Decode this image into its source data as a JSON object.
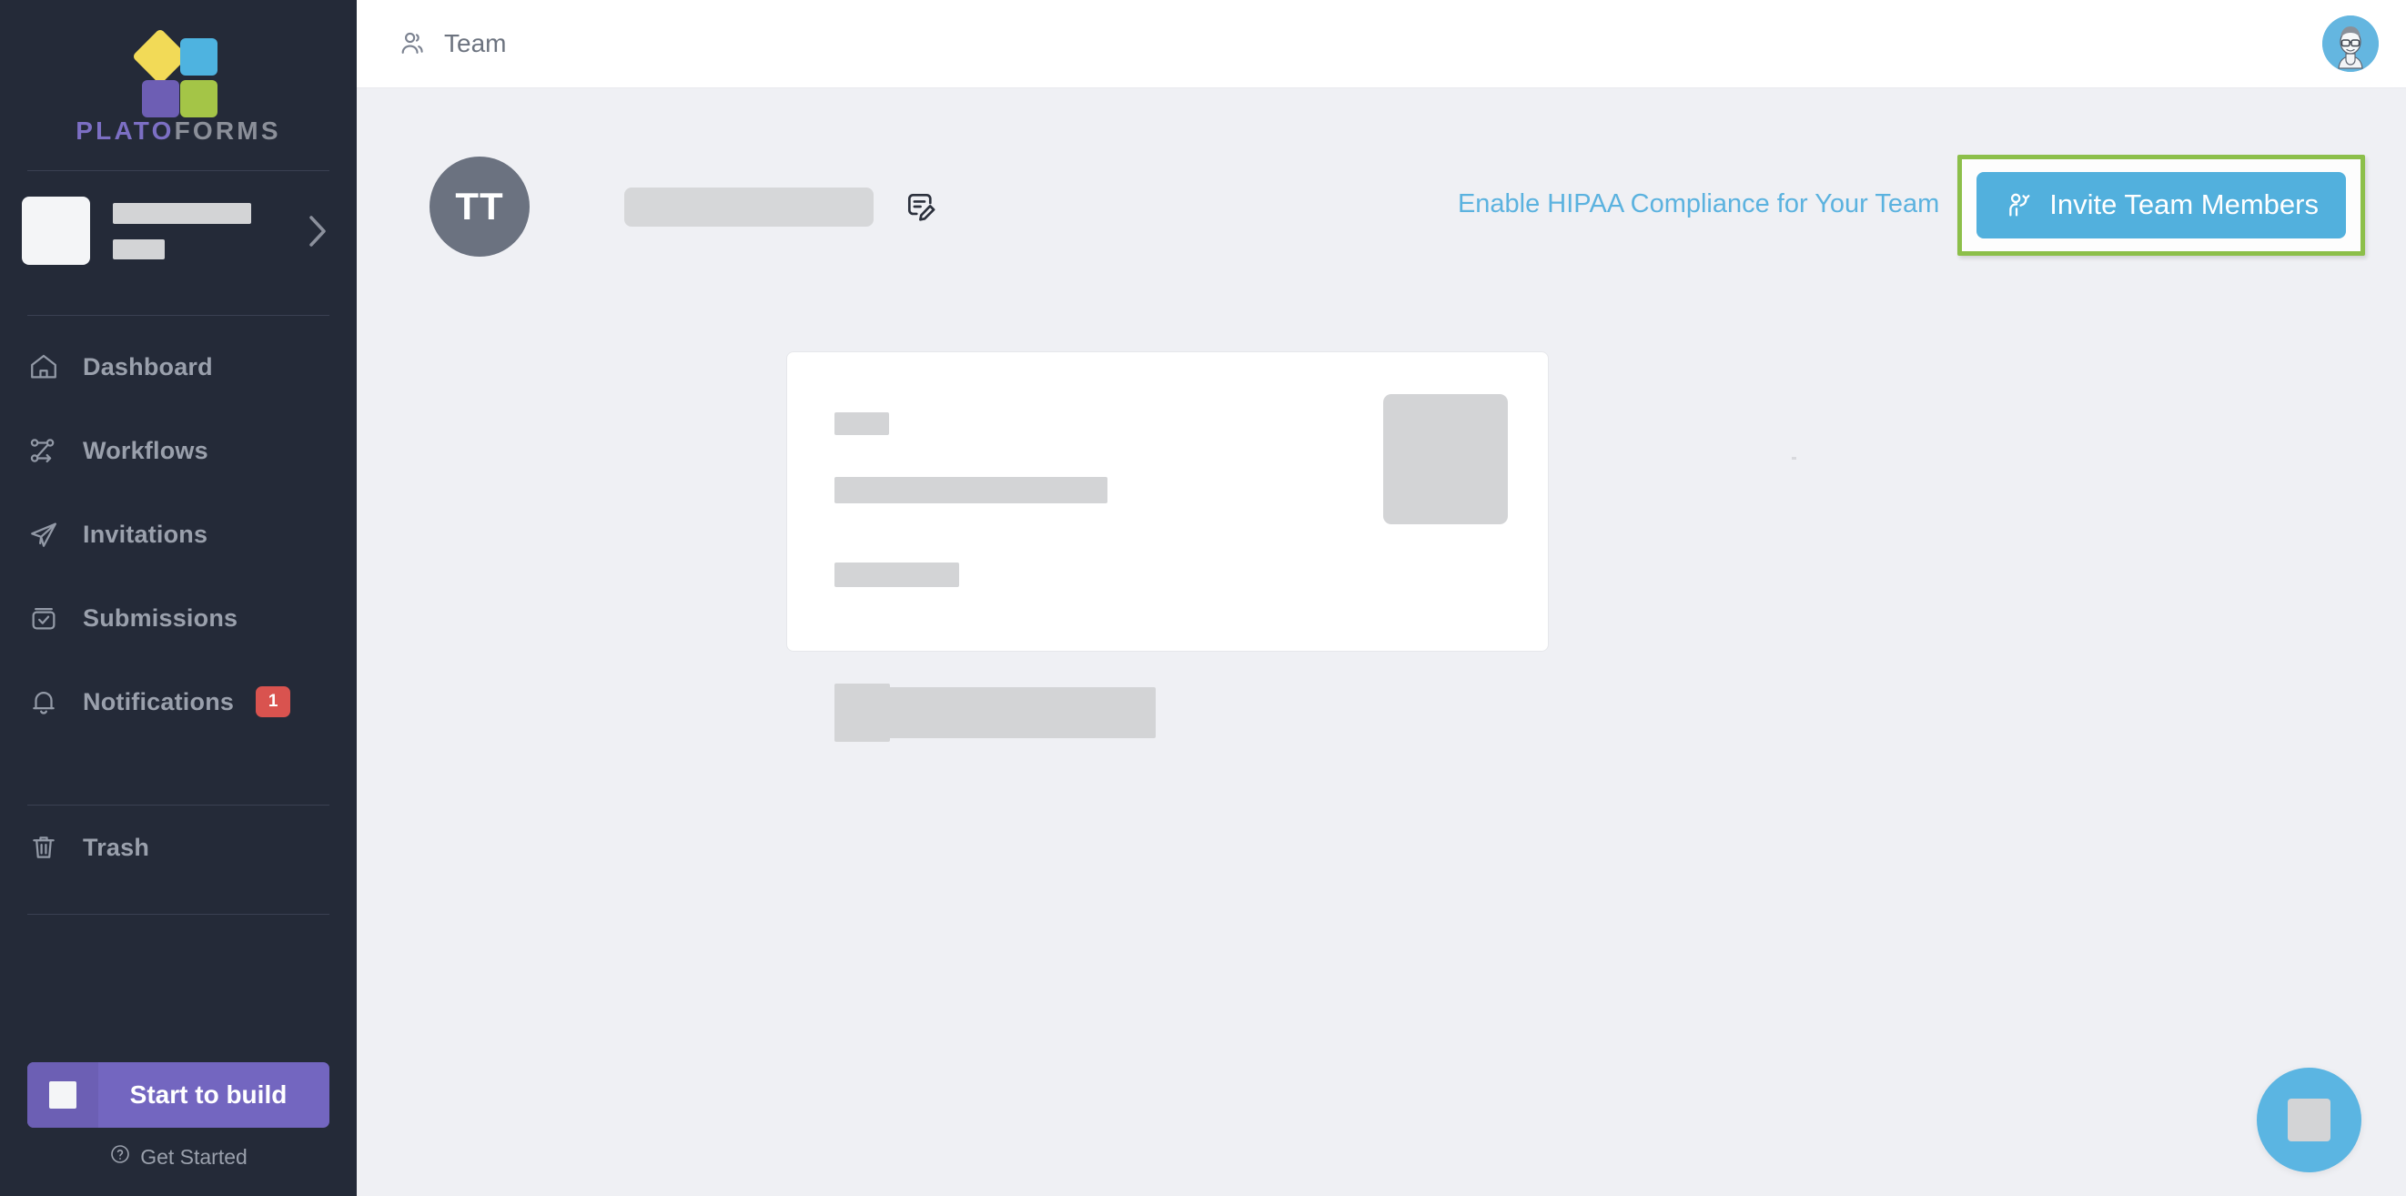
{
  "brand": {
    "name_part_1": "PLATO",
    "name_part_2": "FORMS",
    "accent_purple": "#7c6fc4",
    "accent_blue": "#52b0dd",
    "accent_green": "#a4c547",
    "accent_yellow": "#f2da57"
  },
  "sidebar": {
    "workspace": {
      "name_placeholder": "",
      "sub_placeholder": "",
      "chevron": "chevron-right"
    },
    "items": [
      {
        "label": "Dashboard",
        "icon": "home-icon",
        "badge": ""
      },
      {
        "label": "Workflows",
        "icon": "workflow-icon",
        "badge": ""
      },
      {
        "label": "Invitations",
        "icon": "paper-plane-icon",
        "badge": ""
      },
      {
        "label": "Submissions",
        "icon": "inbox-check-icon",
        "badge": ""
      },
      {
        "label": "Notifications",
        "icon": "bell-icon",
        "badge": "1"
      },
      {
        "label": "Trash",
        "icon": "trash-icon",
        "badge": ""
      }
    ],
    "build_button": {
      "label": "Start to build",
      "icon": "placeholder-square"
    },
    "get_started": {
      "label": "Get Started",
      "icon": "question-circle-icon"
    }
  },
  "topbar": {
    "title": "Team",
    "icon": "team-users-icon",
    "avatar": "user-avatar-glasses"
  },
  "team": {
    "initials": "TT",
    "name_placeholder": "",
    "edit_icon": "edit-document-icon",
    "hipaa_link": "Enable HIPAA Compliance for Your Team",
    "invite_button": {
      "label": "Invite Team Members",
      "icon": "invite-person-icon",
      "highlight_color": "#8cbf4a",
      "background_color": "#52b0dd"
    }
  },
  "content_card": {
    "state": "loading-skeleton",
    "placeholder_count": 6
  },
  "fab": {
    "label": "",
    "icon": "chat-widget-placeholder",
    "color": "#5bb5e2"
  }
}
